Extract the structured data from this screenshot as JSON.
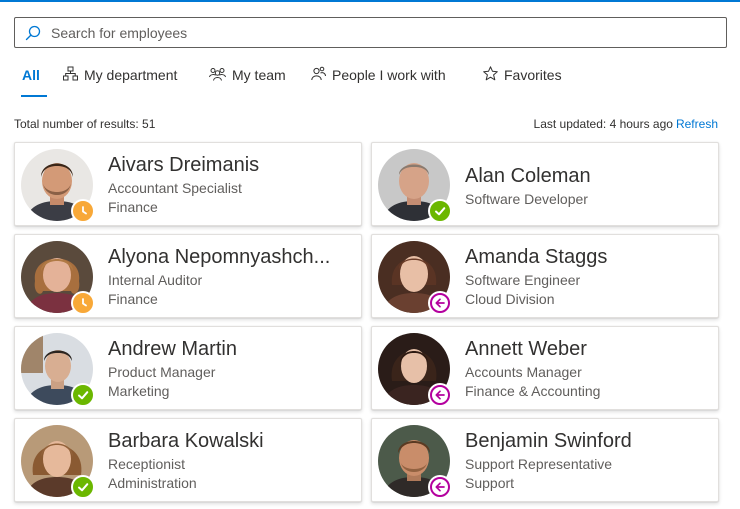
{
  "search": {
    "placeholder": "Search for employees",
    "value": ""
  },
  "tabs": [
    {
      "label": "All",
      "icon": "none",
      "active": true
    },
    {
      "label": "My department",
      "icon": "org-chart-icon"
    },
    {
      "label": "My team",
      "icon": "team-icon"
    },
    {
      "label": "People I work with",
      "icon": "people-icon"
    },
    {
      "label": "Favorites",
      "icon": "star-icon"
    }
  ],
  "results": {
    "total_text": "Total number of results: 51",
    "updated_text": "Last updated: 4 hours ago",
    "refresh_label": "Refresh"
  },
  "colors": {
    "accent": "#0078d4",
    "available": "#6bb700",
    "away": "#f8a838",
    "out_of_office": "#b4009e"
  },
  "people": [
    {
      "name": "Aivars Dreimanis",
      "title": "Accountant Specialist",
      "department": "Finance",
      "presence": "away"
    },
    {
      "name": "Alan Coleman",
      "title": "Software Developer",
      "department": "",
      "presence": "available"
    },
    {
      "name": "Alyona Nepomnyashch...",
      "title": "Internal Auditor",
      "department": "Finance",
      "presence": "away"
    },
    {
      "name": "Amanda Staggs",
      "title": "Software Engineer",
      "department": "Cloud Division",
      "presence": "out-of-office"
    },
    {
      "name": "Andrew Martin",
      "title": "Product Manager",
      "department": "Marketing",
      "presence": "available"
    },
    {
      "name": "Annett Weber",
      "title": "Accounts Manager",
      "department": "Finance & Accounting",
      "presence": "out-of-office"
    },
    {
      "name": "Barbara Kowalski",
      "title": "Receptionist",
      "department": "Administration",
      "presence": "available"
    },
    {
      "name": "Benjamin Swinford",
      "title": "Support Representative",
      "department": "Support",
      "presence": "out-of-office"
    }
  ]
}
